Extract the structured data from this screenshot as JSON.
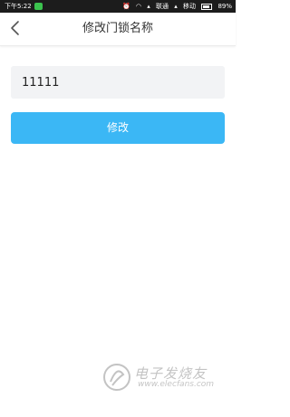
{
  "status_bar": {
    "time": "下午5:22",
    "carrier": "联通",
    "network": "移动",
    "battery": "89%"
  },
  "header": {
    "title": "修改门锁名称",
    "back_icon": "chevron-left-icon"
  },
  "form": {
    "name_value": "11111",
    "submit_label": "修改"
  },
  "watermark": {
    "text": "电子发烧友",
    "url": "www.elecfans.com"
  },
  "colors": {
    "accent": "#3bb7f5",
    "input_bg": "#f2f3f5",
    "status_bar": "#1c1c1c"
  }
}
